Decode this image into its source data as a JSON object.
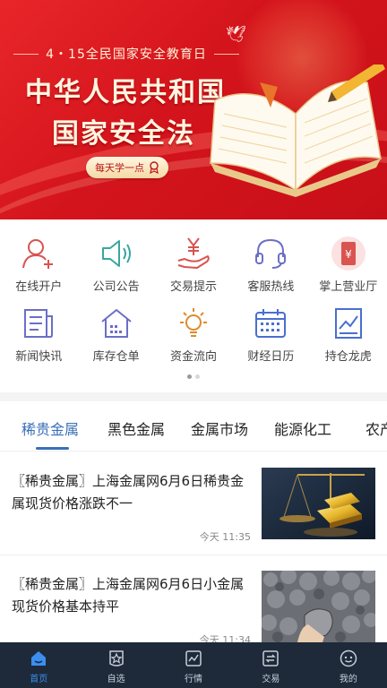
{
  "banner": {
    "subtitle": "4・15全民国家安全教育日",
    "title_line1": "中华人民共和国",
    "title_line2": "国家安全法",
    "chip": "每天学一点"
  },
  "grid": [
    {
      "label": "在线开户",
      "icon": "user-add-icon"
    },
    {
      "label": "公司公告",
      "icon": "speaker-icon"
    },
    {
      "label": "交易提示",
      "icon": "yen-hand-icon"
    },
    {
      "label": "客服热线",
      "icon": "headset-icon"
    },
    {
      "label": "掌上营业厅",
      "icon": "phone-yen-icon"
    },
    {
      "label": "新闻快讯",
      "icon": "newspaper-icon"
    },
    {
      "label": "库存仓单",
      "icon": "warehouse-icon"
    },
    {
      "label": "资金流向",
      "icon": "lightbulb-icon"
    },
    {
      "label": "财经日历",
      "icon": "calendar-icon"
    },
    {
      "label": "持仓龙虎",
      "icon": "chart-doc-icon"
    }
  ],
  "tabs": [
    "稀贵金属",
    "黑色金属",
    "金属市场",
    "能源化工",
    "农产"
  ],
  "news": [
    {
      "title": "〖稀贵金属〗上海金属网6月6日稀贵金属现货价格涨跌不一",
      "time": "今天 11:35",
      "thumb": "gold-bars-image"
    },
    {
      "title": "〖稀贵金属〗上海金属网6月6日小金属现货价格基本持平",
      "time": "今天 11:34",
      "thumb": "metal-ore-image"
    }
  ],
  "nav": [
    {
      "label": "首页",
      "icon": "home-icon"
    },
    {
      "label": "自选",
      "icon": "star-icon"
    },
    {
      "label": "行情",
      "icon": "chart-line-icon"
    },
    {
      "label": "交易",
      "icon": "exchange-icon"
    },
    {
      "label": "我的",
      "icon": "smile-icon"
    }
  ],
  "colors": {
    "accent": "#3a6fb8",
    "banner_red": "#d4141c",
    "nav_bg": "#1e2a3a",
    "icon_red": "#d9534f",
    "icon_teal": "#3aa6a0",
    "icon_purple": "#6a6fc8",
    "icon_orange": "#e08a2b",
    "icon_blue": "#4a6fd0"
  }
}
